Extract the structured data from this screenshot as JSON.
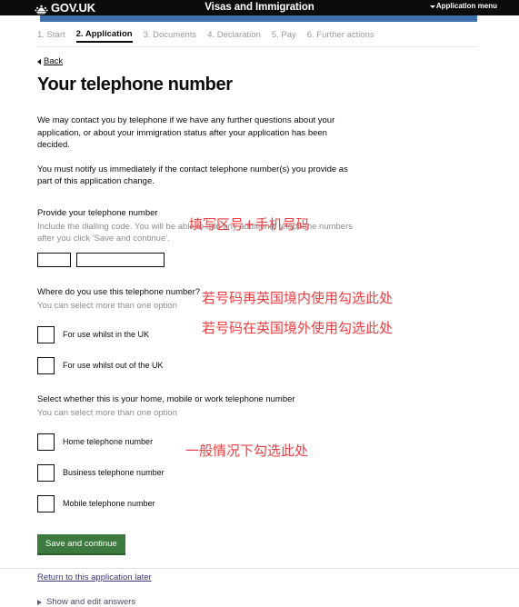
{
  "header": {
    "brand": "GOV.UK",
    "crown_icon": "crown-icon",
    "title": "Visas and Immigration",
    "menu_label": "Application menu",
    "menu_caret_icon": "chevron-down-icon",
    "background_color": "#0b0c0c",
    "accent_bar_color": "#3f6fad"
  },
  "steps": [
    {
      "label": "1. Start",
      "active": false
    },
    {
      "label": "2. Application",
      "active": true
    },
    {
      "label": "3. Documents",
      "active": false
    },
    {
      "label": "4. Declaration",
      "active": false
    },
    {
      "label": "5. Pay",
      "active": false
    },
    {
      "label": "6. Further actions",
      "active": false
    }
  ],
  "back": {
    "label": "Back",
    "icon": "chevron-left-icon"
  },
  "main": {
    "page_title": "Your telephone number",
    "paragraph_1": "We may contact you by telephone if we have any further questions about your application, or about your immigration status after your application has been decided.",
    "paragraph_2": "You must notify us immediately if the contact telephone number(s) you provide as part of this application change.",
    "provide_number": {
      "label": "Provide your telephone number",
      "hint": "Include the dialling code. You will be able to add any additional telephone numbers after you click 'Save and continue'.",
      "dialling_code_value": "",
      "dialling_code_placeholder": "",
      "number_value": "",
      "number_placeholder": ""
    },
    "where_used": {
      "label": "Where do you use this telephone number?",
      "hint": "You can select more than one option",
      "options": [
        {
          "label": "For use whilst in the UK",
          "checked": false
        },
        {
          "label": "For use whilst out of the UK",
          "checked": false
        }
      ]
    },
    "number_type": {
      "label": "Select whether this is your home, mobile or work telephone number",
      "hint": "You can select more than one option",
      "options": [
        {
          "label": "Home telephone number",
          "checked": false
        },
        {
          "label": "Business telephone number",
          "checked": false
        },
        {
          "label": "Mobile telephone number",
          "checked": false
        }
      ]
    }
  },
  "annotations": {
    "color": "#ef3e42",
    "phone_fields": "填写区号+手机号码",
    "in_uk": "若号码再英国境内使用勾选此处",
    "out_uk": "若号码在英国境外使用勾选此处",
    "mobile": "一般情况下勾选此处"
  },
  "actions": {
    "save_label": "Save and continue",
    "save_color": "#3d7a3f",
    "return_link": "Return to this application later",
    "show_answers": "Show and edit answers",
    "show_answers_icon": "triangle-right-icon"
  }
}
